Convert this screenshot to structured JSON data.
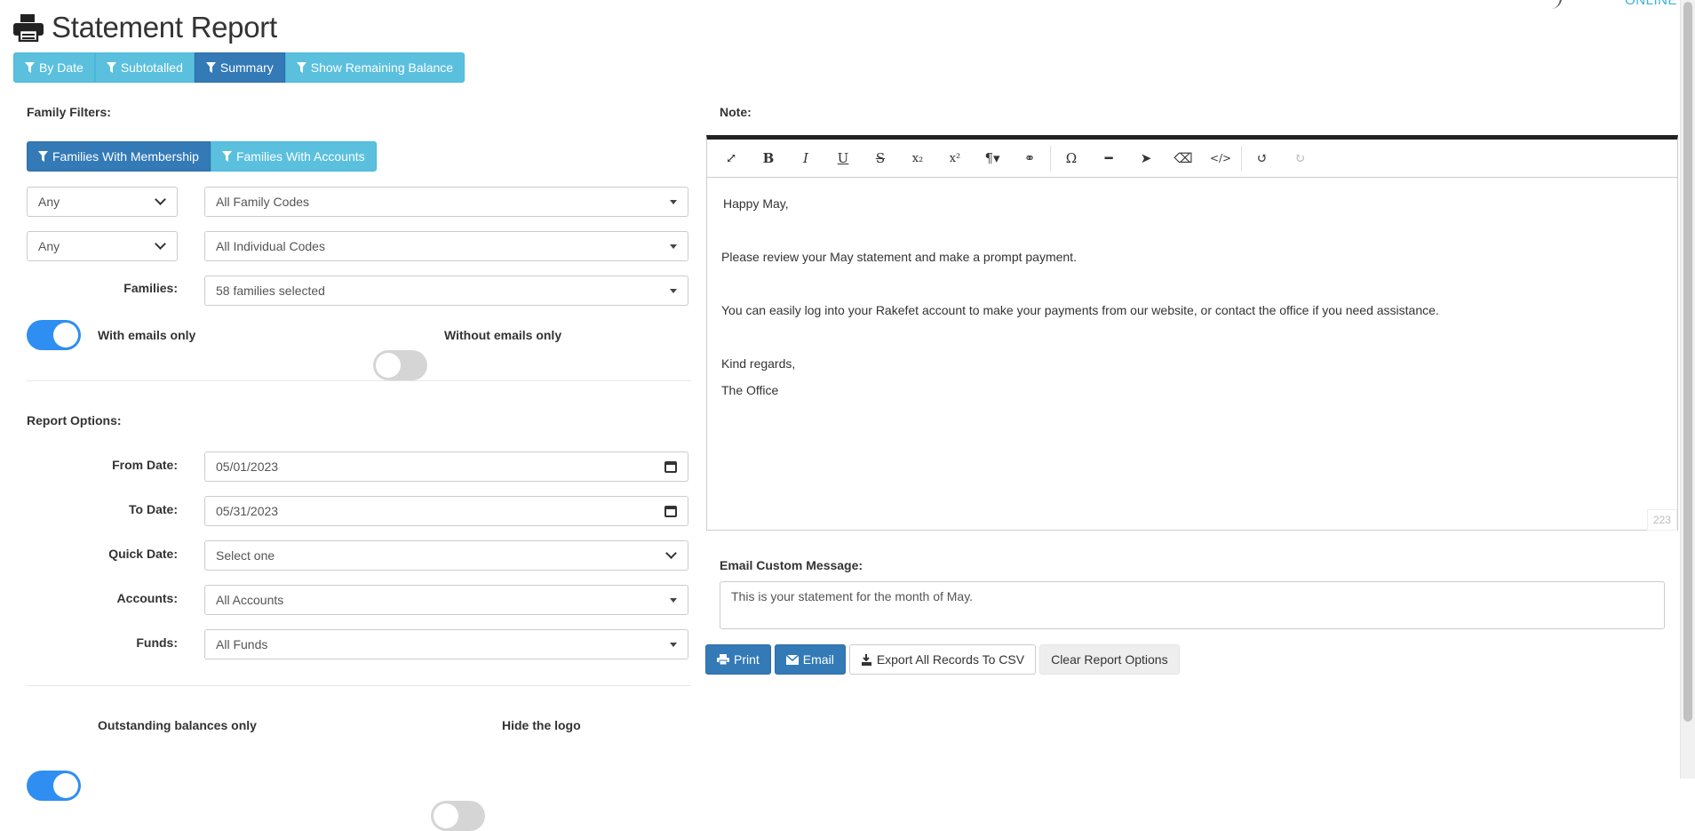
{
  "header": {
    "title": "Statement Report",
    "brand_online": "ONLINE"
  },
  "view_filters": [
    {
      "label": "By Date",
      "active": false
    },
    {
      "label": "Subtotalled",
      "active": false
    },
    {
      "label": "Summary",
      "active": true
    },
    {
      "label": "Show Remaining Balance",
      "active": false
    }
  ],
  "family_filters": {
    "label": "Family Filters:",
    "tabs": [
      {
        "label": "Families With Membership",
        "active": true
      },
      {
        "label": "Families With Accounts",
        "active": false
      }
    ],
    "family_code_scope": "Any",
    "family_codes": "All Family Codes",
    "individual_code_scope": "Any",
    "individual_codes": "All Individual Codes",
    "families_label": "Families:",
    "families_value": "58 families selected",
    "with_emails_label": "With emails only",
    "with_emails_on": true,
    "without_emails_label": "Without emails only",
    "without_emails_on": false
  },
  "report_options": {
    "label": "Report Options:",
    "from_date_label": "From Date:",
    "from_date": "05/01/2023",
    "to_date_label": "To Date:",
    "to_date": "05/31/2023",
    "quick_date_label": "Quick Date:",
    "quick_date": "Select one",
    "accounts_label": "Accounts:",
    "accounts": "All Accounts",
    "funds_label": "Funds:",
    "funds": "All Funds",
    "outstanding_label": "Outstanding balances only",
    "outstanding_on": true,
    "hide_logo_label": "Hide the logo",
    "hide_logo_on": false
  },
  "note": {
    "label": "Note:",
    "lines": [
      "Happy May,",
      "",
      "Please review your May statement and make a prompt payment.",
      "",
      "You can easily log into your Rakefet account to make your payments from our website, or contact the office if you need assistance.",
      "",
      "Kind regards,",
      "The Office"
    ],
    "char_count": "223",
    "toolbar": [
      "expand-icon",
      "bold-icon",
      "italic-icon",
      "underline-icon",
      "strikethrough-icon",
      "subscript-icon",
      "superscript-icon",
      "paragraph-icon",
      "link-icon",
      "omega-icon",
      "horizontal-rule-icon",
      "cursor-icon",
      "eraser-icon",
      "code-icon",
      "undo-icon",
      "redo-icon"
    ]
  },
  "email_message": {
    "label": "Email Custom Message:",
    "value": "This is your statement for the month of May."
  },
  "actions": {
    "print": "Print",
    "email": "Email",
    "export": "Export All Records To CSV",
    "clear": "Clear Report Options"
  },
  "colors": {
    "primary": "#337ab7",
    "info": "#5bc0de",
    "toggle_on": "#2f8ef2",
    "toggle_off": "#d5d5d5"
  }
}
